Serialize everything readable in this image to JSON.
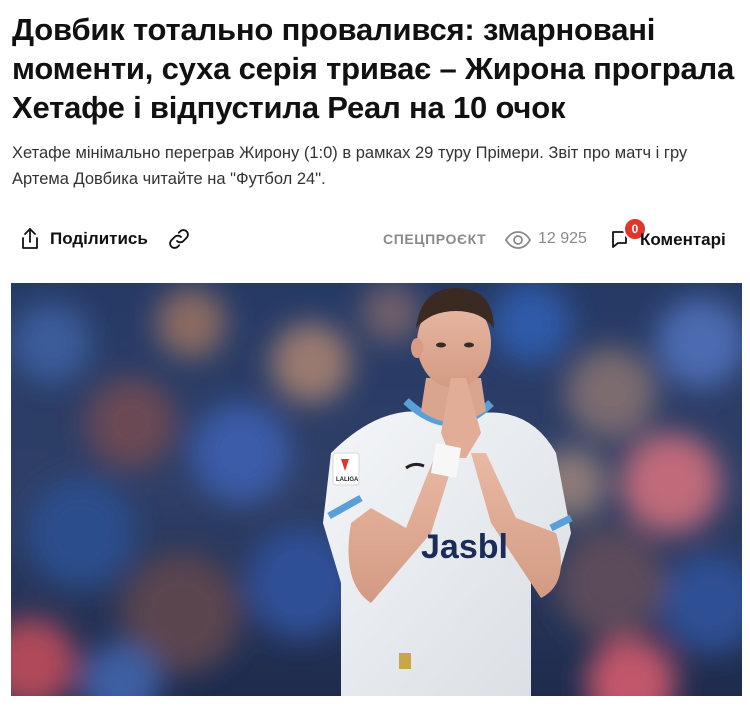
{
  "article": {
    "title": "Довбик тотально провалився: змарновані моменти, суха серія триває – Жирона програла Хетафе і відпустила Реал на 10 очок",
    "lead": "Хетафе мінімально переграв Жирону (1:0) в рамках 29 туру Прімери. Звіт про матч і гру Артема Довбика читайте на \"Футбол 24\"."
  },
  "toolbar": {
    "share_label": "Поділитись",
    "special_label": "СПЕЦПРОЄКТ",
    "views": "12 925",
    "comments_count": "0",
    "comments_label": "Коментарі"
  },
  "photo": {
    "jersey_sponsor": "Jasbl",
    "sleeve_badge": "LALIGA",
    "accent_color": "#e0362b"
  }
}
